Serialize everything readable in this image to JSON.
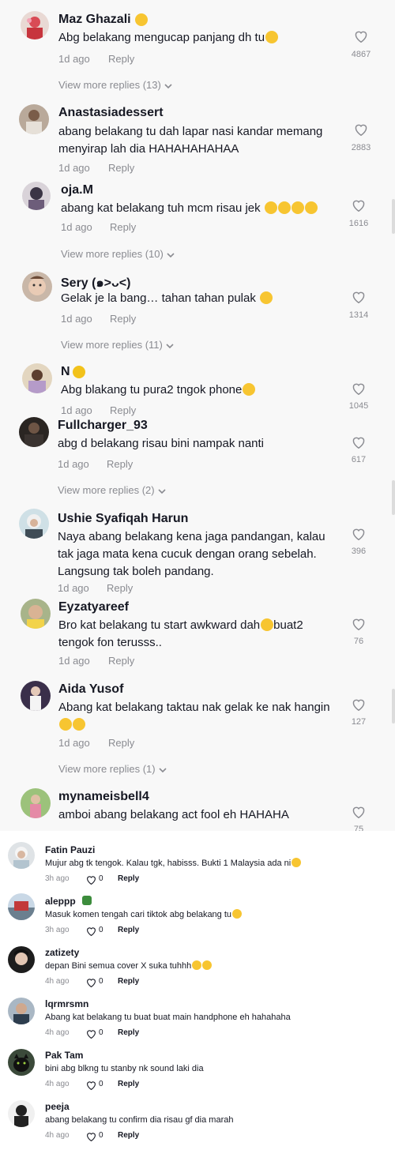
{
  "top_comments": [
    {
      "username": "Maz Ghazali",
      "text": "Abg belakang mengucap panjang dh tu",
      "time": "1d ago",
      "reply": "Reply",
      "likes": "4867",
      "view_more": "View more replies (13)"
    },
    {
      "username": "Anastasiadessert",
      "text": "abang belakang tu dah lapar nasi kandar memang\nmenyirap lah dia HAHAHAHAHAA",
      "time": "1d ago",
      "reply": "Reply",
      "likes": "2883"
    },
    {
      "username": "oja.M",
      "text": "abang kat belakang tuh mcm risau jek",
      "time": "1d ago",
      "reply": "Reply",
      "likes": "1616",
      "view_more": "View more replies (10)"
    },
    {
      "username": "Sery (๑˃ᴗ˂)",
      "text": "Gelak je la bang… tahan tahan pulak",
      "time": "1d ago",
      "reply": "Reply",
      "likes": "1314",
      "view_more": "View more replies (11)"
    },
    {
      "username": "N",
      "text": "Abg blakang tu pura2 tngok phone",
      "time": "1d ago",
      "reply": "Reply",
      "likes": "1045"
    },
    {
      "username": "Fullcharger_93",
      "text": "abg d belakang risau bini nampak nanti",
      "time": "1d ago",
      "reply": "Reply",
      "likes": "617",
      "view_more": "View more replies (2)"
    },
    {
      "username": "Ushie Syafiqah Harun",
      "text": "Naya abang belakang kena jaga pandangan, kalau\ntak jaga mata kena cucuk dengan orang sebelah.\nLangsung tak boleh pandang.",
      "time": "1d ago",
      "reply": "Reply",
      "likes": "396"
    },
    {
      "username": "Eyzatyareef",
      "text_a": "Bro kat belakang tu start awkward dah",
      "text_b": "buat2",
      "text_c": "tengok fon terusss..",
      "time": "1d ago",
      "reply": "Reply",
      "likes": "76"
    },
    {
      "username": "Aida Yusof",
      "text": "Abang kat belakang taktau nak gelak ke nak hangin",
      "time": "1d ago",
      "reply": "Reply",
      "likes": "127",
      "view_more": "View more replies (1)"
    },
    {
      "username": "mynameisbell4",
      "text": "amboi abang belakang act fool eh HAHAHA",
      "likes": "75"
    }
  ],
  "bottom_comments": [
    {
      "username": "Fatin Pauzi",
      "text": "Mujur abg tk tengok. Kalau tgk, habisss. Bukti 1 Malaysia ada ni",
      "time": "3h ago",
      "likes": "0",
      "reply": "Reply"
    },
    {
      "username": "aleppp",
      "text": "Masuk komen tengah cari tiktok abg belakang tu",
      "time": "3h ago",
      "likes": "0",
      "reply": "Reply"
    },
    {
      "username": "zatizety",
      "text": "depan Bini semua cover X suka tuhhh",
      "time": "4h ago",
      "likes": "0",
      "reply": "Reply"
    },
    {
      "username": "lqrmrsmn",
      "text": "Abang kat belakang tu buat buat main handphone eh hahahaha",
      "time": "4h ago",
      "likes": "0",
      "reply": "Reply"
    },
    {
      "username": "Pak Tam",
      "text": "bini abg blkng tu stanby nk sound laki dia",
      "time": "4h ago",
      "likes": "0",
      "reply": "Reply"
    },
    {
      "username": "peeja",
      "text": "abang belakang tu confirm dia risau gf dia marah",
      "time": "4h ago",
      "likes": "0",
      "reply": "Reply"
    }
  ],
  "colors": {
    "muted": "#8a8b91",
    "text": "#161823",
    "emoji": "#f7c531"
  }
}
